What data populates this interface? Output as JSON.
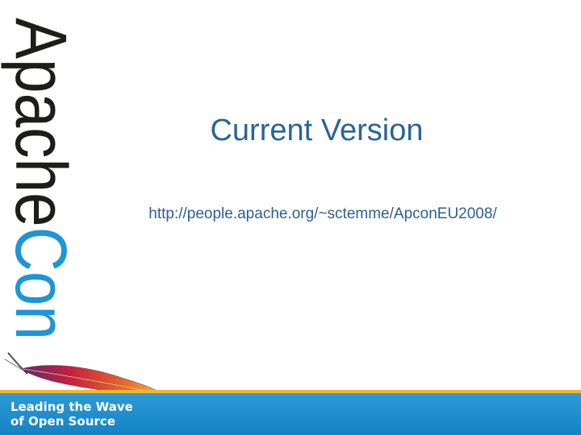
{
  "logo": {
    "text_dark": "Apache",
    "text_accent": "Con",
    "colors": {
      "dark": "#1d1d1b",
      "accent": "#1d95d6"
    }
  },
  "slide": {
    "title": "Current Version",
    "url": "http://people.apache.org/~sctemme/ApconEU2008/"
  },
  "footer": {
    "tagline_line1": "Leading the Wave",
    "tagline_line2": "of Open Source",
    "colors": {
      "bar": "#1383c5",
      "stripe": "#f0b82e"
    }
  }
}
